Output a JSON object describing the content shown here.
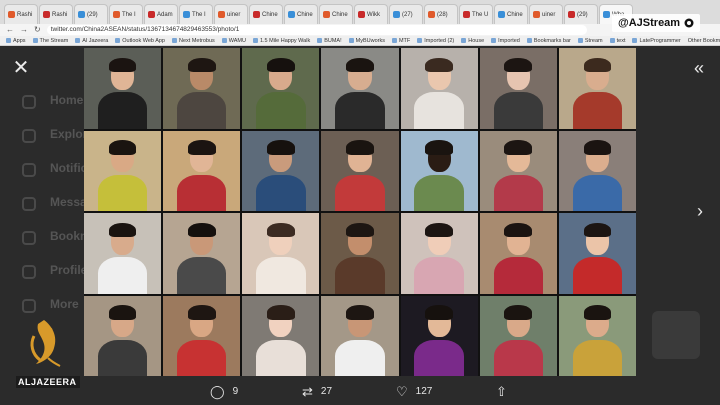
{
  "browser": {
    "tabs": [
      {
        "label": "Rashi"
      },
      {
        "label": "Rashi"
      },
      {
        "label": "(29)"
      },
      {
        "label": "The I"
      },
      {
        "label": "Adam"
      },
      {
        "label": "The I"
      },
      {
        "label": "uiner"
      },
      {
        "label": "Chine"
      },
      {
        "label": "Chine"
      },
      {
        "label": "Chine"
      },
      {
        "label": "Wikk"
      },
      {
        "label": "(27)"
      },
      {
        "label": "(28)"
      },
      {
        "label": "The U"
      },
      {
        "label": "Chine"
      },
      {
        "label": "uiner"
      },
      {
        "label": "(29)"
      },
      {
        "label": "Wha"
      }
    ],
    "url": "twitter.com/China2ASEAN/status/1367134674829463553/photo/1",
    "bookmarks": [
      "Apps",
      "The Stream",
      "Al Jazeera",
      "Outlook Web App",
      "Next Metrobus",
      "WAMU",
      "1.5 Mile Happy Walk",
      "BUMA!",
      "MyBUworks",
      "MTF",
      "Imported (2)",
      "House",
      "Imported",
      "Bookmarks bar",
      "Stream",
      "text",
      "LateProgrammer"
    ],
    "bookmarks_right": "Other Bookmarks"
  },
  "twitter_bg": {
    "sidebar": [
      "Home",
      "Explore",
      "Notifications",
      "Messages",
      "Bookmarks",
      "Profile",
      "More"
    ]
  },
  "photo_grid": {
    "rows": 4,
    "cols": 7,
    "cells": [
      {
        "bg": "#5b5e57",
        "skin": "#e0b596",
        "hair": "#1b1411",
        "body": "#1f1f1f"
      },
      {
        "bg": "#6f6a55",
        "skin": "#b98a68",
        "hair": "#1e1612",
        "body": "#4d4640"
      },
      {
        "bg": "#5f6a4d",
        "skin": "#d8aa8c",
        "hair": "#16110e",
        "body": "#556b3a"
      },
      {
        "bg": "#8a8a86",
        "skin": "#d7ad90",
        "hair": "#1a1410",
        "body": "#2a2a2a"
      },
      {
        "bg": "#b7b1ab",
        "skin": "#eac7ae",
        "hair": "#3a2a20",
        "body": "#e7e3de"
      },
      {
        "bg": "#7a6e66",
        "skin": "#e6c4b0",
        "hair": "#1c1512",
        "body": "#3a3a3a"
      },
      {
        "bg": "#b9a88b",
        "skin": "#d9ad8e",
        "hair": "#3c2a1e",
        "body": "#a53a2b"
      },
      {
        "bg": "#c9b48a",
        "skin": "#d9a985",
        "hair": "#1a1410",
        "body": "#c5bf3a"
      },
      {
        "bg": "#c9a87a",
        "skin": "#e1b596",
        "hair": "#1b1411",
        "body": "#b82f34"
      },
      {
        "bg": "#5d6b7a",
        "skin": "#c99b7c",
        "hair": "#16110e",
        "body": "#2a4d7a"
      },
      {
        "bg": "#6c5f54",
        "skin": "#e0b394",
        "hair": "#1a1410",
        "body": "#c23a3a"
      },
      {
        "bg": "#9fb9cf",
        "skin": "#2a1c14",
        "hair": "#1a1410",
        "body": "#6b8a4f"
      },
      {
        "bg": "#9a8c7c",
        "skin": "#e4b998",
        "hair": "#1c1512",
        "body": "#b33a4a"
      },
      {
        "bg": "#8a7f79",
        "skin": "#dcae8e",
        "hair": "#1b1411",
        "body": "#3a6aa8"
      },
      {
        "bg": "#c7c1b8",
        "skin": "#d8ab8c",
        "hair": "#1a1410",
        "body": "#efefef"
      },
      {
        "bg": "#b6a592",
        "skin": "#c99878",
        "hair": "#15100d",
        "body": "#4a4a4a"
      },
      {
        "bg": "#d9c7b8",
        "skin": "#efd0bc",
        "hair": "#3c2b22",
        "body": "#f0e8e0"
      },
      {
        "bg": "#6c5a48",
        "skin": "#c38e6c",
        "hair": "#1d1612",
        "body": "#5a3a2a"
      },
      {
        "bg": "#cfc2bb",
        "skin": "#f0cdb8",
        "hair": "#1c1512",
        "body": "#d8a6b2"
      },
      {
        "bg": "#a88b70",
        "skin": "#e1b393",
        "hair": "#1b1411",
        "body": "#b52a3a"
      },
      {
        "bg": "#5b6f88",
        "skin": "#ebc4a8",
        "hair": "#1c1512",
        "body": "#c42a2a"
      },
      {
        "bg": "#a59684",
        "skin": "#d7a888",
        "hair": "#1a1410",
        "body": "#3a3a3a"
      },
      {
        "bg": "#9c7a5e",
        "skin": "#d9a784",
        "hair": "#1e1612",
        "body": "#c73232"
      },
      {
        "bg": "#7f7a74",
        "skin": "#f1d2c0",
        "hair": "#2a1e17",
        "body": "#e8dfd8"
      },
      {
        "bg": "#a49888",
        "skin": "#c89676",
        "hair": "#1d1612",
        "body": "#efefef"
      },
      {
        "bg": "#1d1a22",
        "skin": "#e3b998",
        "hair": "#16110e",
        "body": "#7a2a8a"
      },
      {
        "bg": "#6f7f6a",
        "skin": "#d9a989",
        "hair": "#1a1410",
        "body": "#b9384a"
      },
      {
        "bg": "#8a9a7a",
        "skin": "#dcab8b",
        "hair": "#1a1410",
        "body": "#c9a23a"
      }
    ]
  },
  "tweet_actions": {
    "replies": "9",
    "retweets": "27",
    "likes": "127"
  },
  "watermark": {
    "handle": "@AJStream",
    "logo_text": "ALJAZEERA"
  },
  "colors": {
    "overlay_bg": "#2b2b2b",
    "logo_gold": "#d89a2a"
  }
}
